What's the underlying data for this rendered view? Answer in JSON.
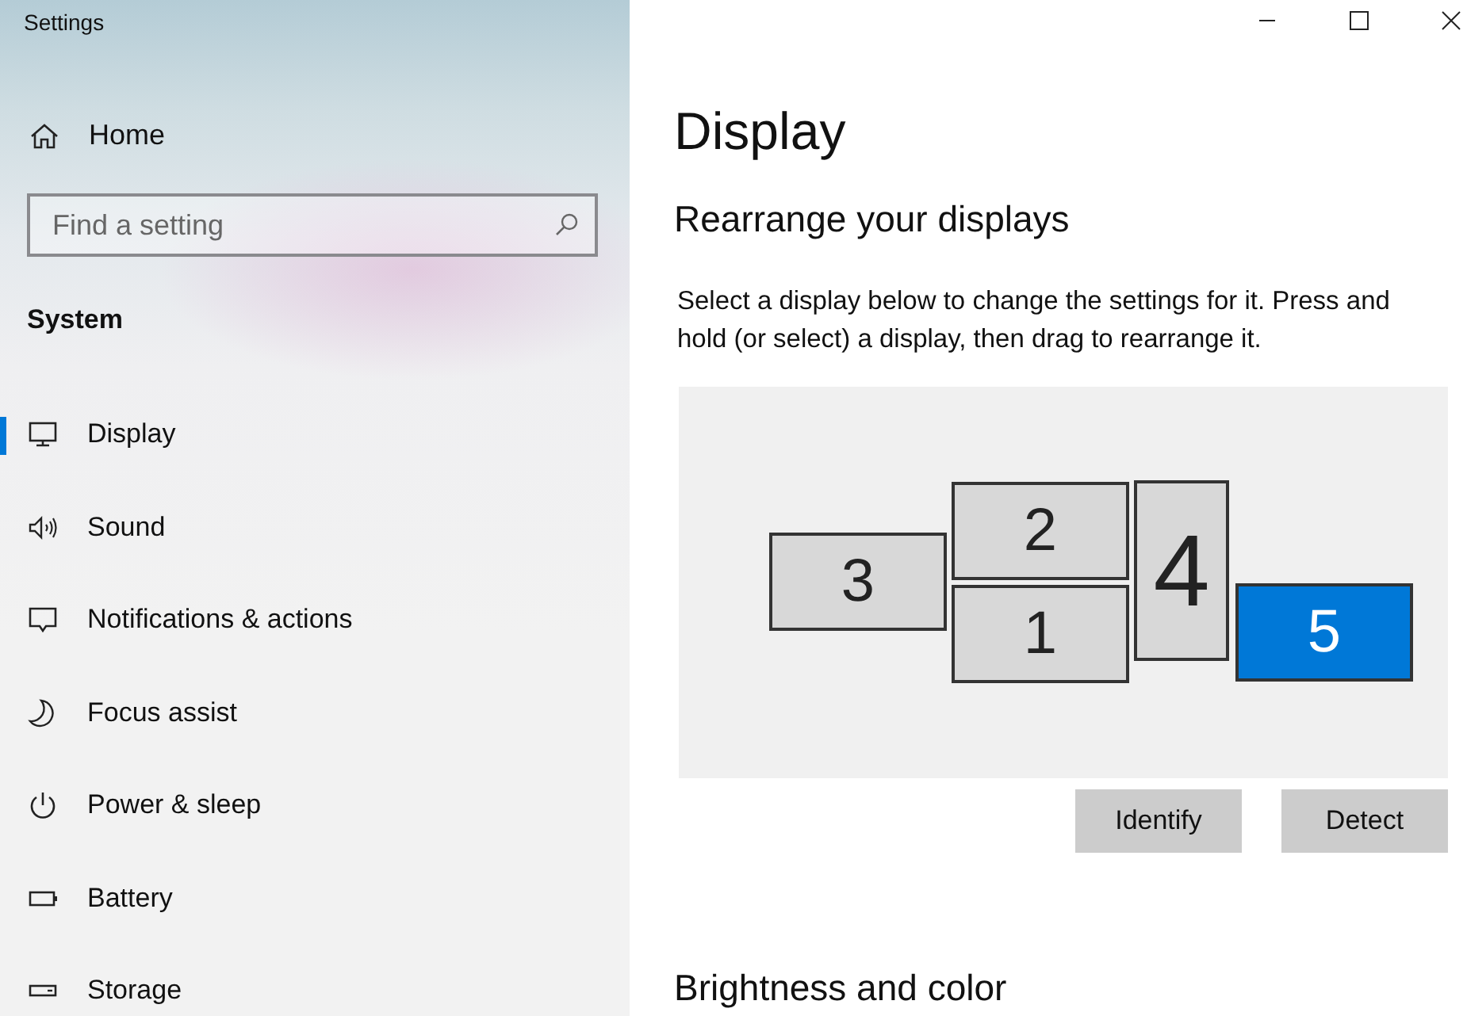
{
  "window": {
    "title": "Settings"
  },
  "sidebar": {
    "home": "Home",
    "search": {
      "placeholder": "Find a setting"
    },
    "section": "System",
    "items": [
      {
        "label": "Display",
        "kind": "display",
        "selected": true
      },
      {
        "label": "Sound",
        "kind": "sound",
        "selected": false
      },
      {
        "label": "Notifications & actions",
        "kind": "notifications",
        "selected": false
      },
      {
        "label": "Focus assist",
        "kind": "focus",
        "selected": false
      },
      {
        "label": "Power & sleep",
        "kind": "power",
        "selected": false
      },
      {
        "label": "Battery",
        "kind": "battery",
        "selected": false
      },
      {
        "label": "Storage",
        "kind": "storage",
        "selected": false
      }
    ]
  },
  "page": {
    "title": "Display",
    "section": "Rearrange your displays",
    "description": "Select a display below to change the settings for it. Press and hold (or select) a display, then drag to rearrange it.",
    "monitors": [
      {
        "label": "3",
        "selected": false
      },
      {
        "label": "2",
        "selected": false
      },
      {
        "label": "1",
        "selected": false
      },
      {
        "label": "4",
        "selected": false
      },
      {
        "label": "5",
        "selected": true
      }
    ],
    "buttons": [
      "Identify",
      "Detect"
    ],
    "next_section": "Brightness and color"
  }
}
